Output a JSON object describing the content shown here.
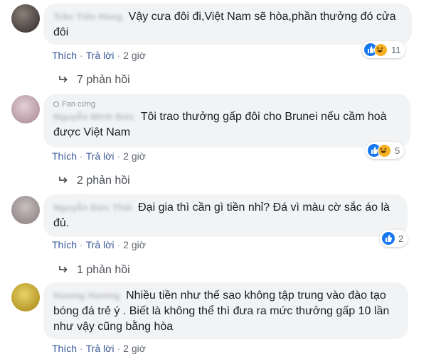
{
  "comments": [
    {
      "author": "Trần Tiến Hùng",
      "badge": "",
      "text": "Vậy cưa đôi đi,Việt Nam sẽ hòa,phần thưởng đó cửa đôi",
      "like_label": "Thích",
      "reply_label": "Trả lời",
      "time": "2 giờ",
      "reaction_count": "11",
      "reactions": [
        "like",
        "haha"
      ],
      "replies_label": "7 phản hồi"
    },
    {
      "author": "Nguyễn Minh Đức",
      "badge": "Fan cứng",
      "text": "Tôi trao thưởng gấp đôi cho Brunei nếu cầm hoà được Việt Nam",
      "like_label": "Thích",
      "reply_label": "Trả lời",
      "time": "2 giờ",
      "reaction_count": "5",
      "reactions": [
        "like",
        "haha"
      ],
      "replies_label": "2 phản hồi"
    },
    {
      "author": "Nguyễn Đức Thái",
      "badge": "",
      "text": "Đại gia thì cần gì tiền nhỉ? Đá vì màu cờ sắc áo là đủ.",
      "like_label": "Thích",
      "reply_label": "Trả lời",
      "time": "2 giờ",
      "reaction_count": "2",
      "reactions": [
        "like"
      ],
      "replies_label": "1 phản hồi"
    },
    {
      "author": "Hương Hương",
      "badge": "",
      "text": "Nhiều tiền như thế sao không tập trung vào đào tạo bóng đá trẻ ý . Biết là không thể thì đưa ra mức thưởng gấp 10 lần như vậy cũng bằng hòa",
      "like_label": "Thích",
      "reply_label": "Trả lời",
      "time": "2 giờ"
    }
  ],
  "colors": {
    "bubble_bg": "#f2f3f5",
    "link": "#385898",
    "like_blue": "#1877f2",
    "haha_yellow": "#f7b125"
  }
}
